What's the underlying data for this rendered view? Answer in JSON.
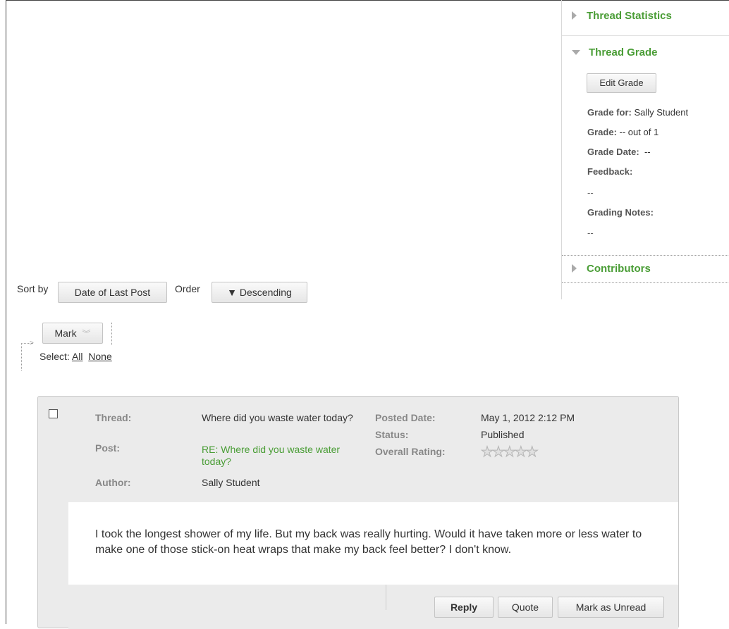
{
  "sidebar": {
    "thread_statistics": "Thread Statistics",
    "thread_grade": "Thread Grade",
    "edit_grade": "Edit Grade",
    "grade_for_label": "Grade for:",
    "grade_for_value": "Sally Student",
    "grade_label": "Grade:",
    "grade_value": "-- out of 1",
    "grade_date_label": "Grade Date:",
    "grade_date_value": "--",
    "feedback_label": "Feedback:",
    "feedback_value": "--",
    "grading_notes_label": "Grading Notes:",
    "grading_notes_value": "--",
    "contributors": "Contributors"
  },
  "sort": {
    "sort_by_label": "Sort by",
    "sort_by_value": "Date of Last Post",
    "order_label": "Order",
    "order_value": "▼ Descending"
  },
  "mark": {
    "mark_label": "Mark",
    "select_label": "Select:",
    "all": "All",
    "none": "None"
  },
  "post": {
    "thread_label": "Thread:",
    "thread_value": "Where did you waste water today?",
    "post_label": "Post:",
    "post_value": "RE: Where did you waste water today?",
    "author_label": "Author:",
    "author_value": "Sally Student",
    "posted_date_label": "Posted Date:",
    "posted_date_value": "May 1, 2012 2:12 PM",
    "status_label": "Status:",
    "status_value": "Published",
    "overall_rating_label": "Overall Rating:",
    "overall_rating": 0,
    "rating_max": 5,
    "body": "I took the longest shower of my life. But my back was really hurting. Would it have taken more or less water to make one of those stick-on heat wraps that make my back feel better? I don't know.",
    "reply": "Reply",
    "quote": "Quote",
    "mark_unread": "Mark as Unread"
  },
  "colors": {
    "accent_green": "#4a9d36"
  }
}
